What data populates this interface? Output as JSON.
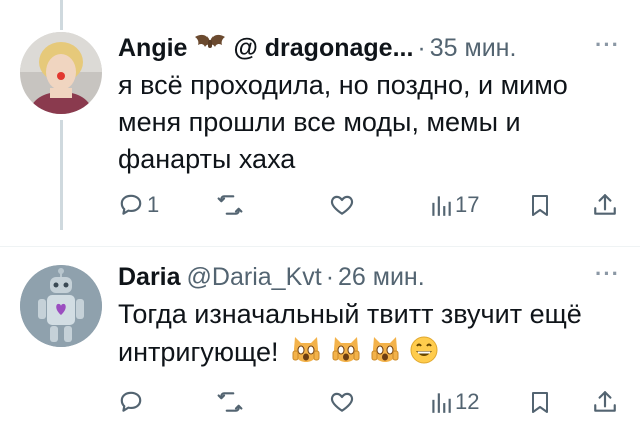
{
  "tweets": [
    {
      "name": "Angie",
      "handle": "@ dragonage...",
      "time": "35 мин.",
      "text": "я всё проходила, но поздно, и мимо меня прошли все моды, мемы и фанарты хаха",
      "actions": {
        "reply_count": "1",
        "retweet_count": "",
        "like_count": "",
        "views_count": "17"
      },
      "avatar": "photo-avatar",
      "badge_icon": "bat-emoji"
    },
    {
      "name": "Daria",
      "handle": "@Daria_Kvt",
      "time": "26 мин.",
      "text": "Тогда изначальный твитт звучит ещё интригующе!",
      "actions": {
        "reply_count": "",
        "retweet_count": "",
        "like_count": "",
        "views_count": "12"
      },
      "avatar": "robot-avatar",
      "reactions": [
        "weary-cat-emoji",
        "weary-cat-emoji",
        "weary-cat-emoji",
        "grinning-face-emoji"
      ]
    }
  ],
  "separator": "·",
  "more_icon": "···",
  "colors": {
    "text": "#0f1419",
    "muted": "#536471",
    "thread_line": "#cfd9de",
    "background": "#ffffff"
  }
}
